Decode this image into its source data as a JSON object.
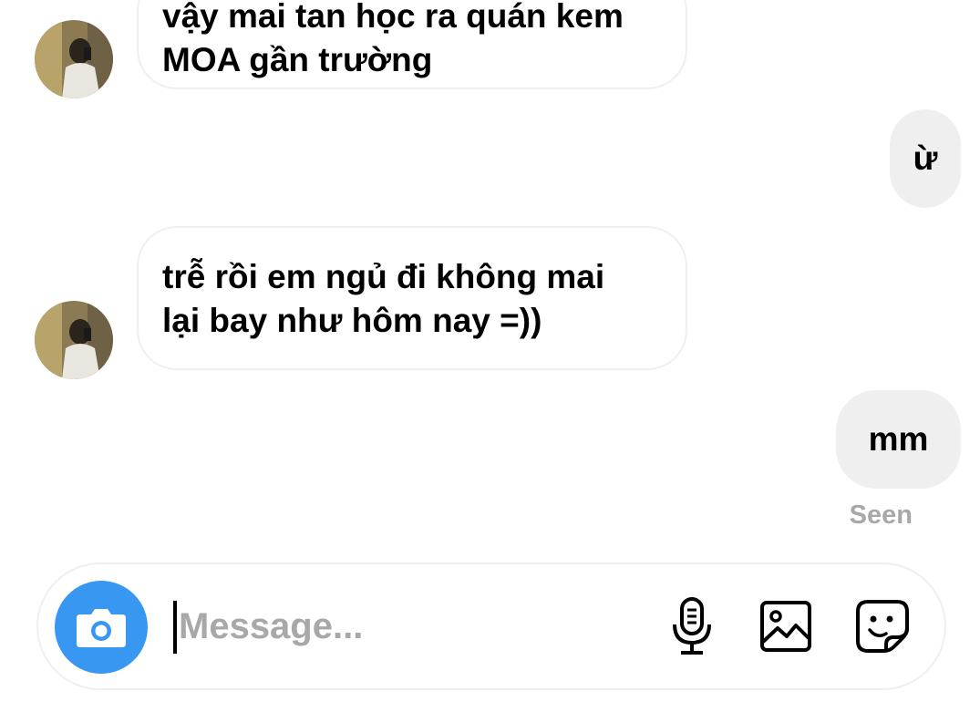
{
  "conversation": {
    "messages": [
      {
        "sender": "other",
        "lines": [
          "vậy mai tan học ra quán kem",
          "MOA gần trường"
        ]
      },
      {
        "sender": "me",
        "text": "ừ"
      },
      {
        "sender": "other",
        "lines": [
          "trễ rồi em ngủ đi không mai",
          "lại bay như hôm nay =))"
        ]
      },
      {
        "sender": "me",
        "text": "mm"
      }
    ],
    "seen_label": "Seen"
  },
  "composer": {
    "placeholder": "Message...",
    "value": ""
  },
  "icons": {
    "camera": "camera-icon",
    "microphone": "microphone-icon",
    "gallery": "gallery-icon",
    "sticker": "sticker-icon"
  },
  "colors": {
    "accent": "#3897f0",
    "incoming_border": "#efefef",
    "outgoing_bg": "#efefef",
    "seen_text": "#a8a8a8"
  }
}
